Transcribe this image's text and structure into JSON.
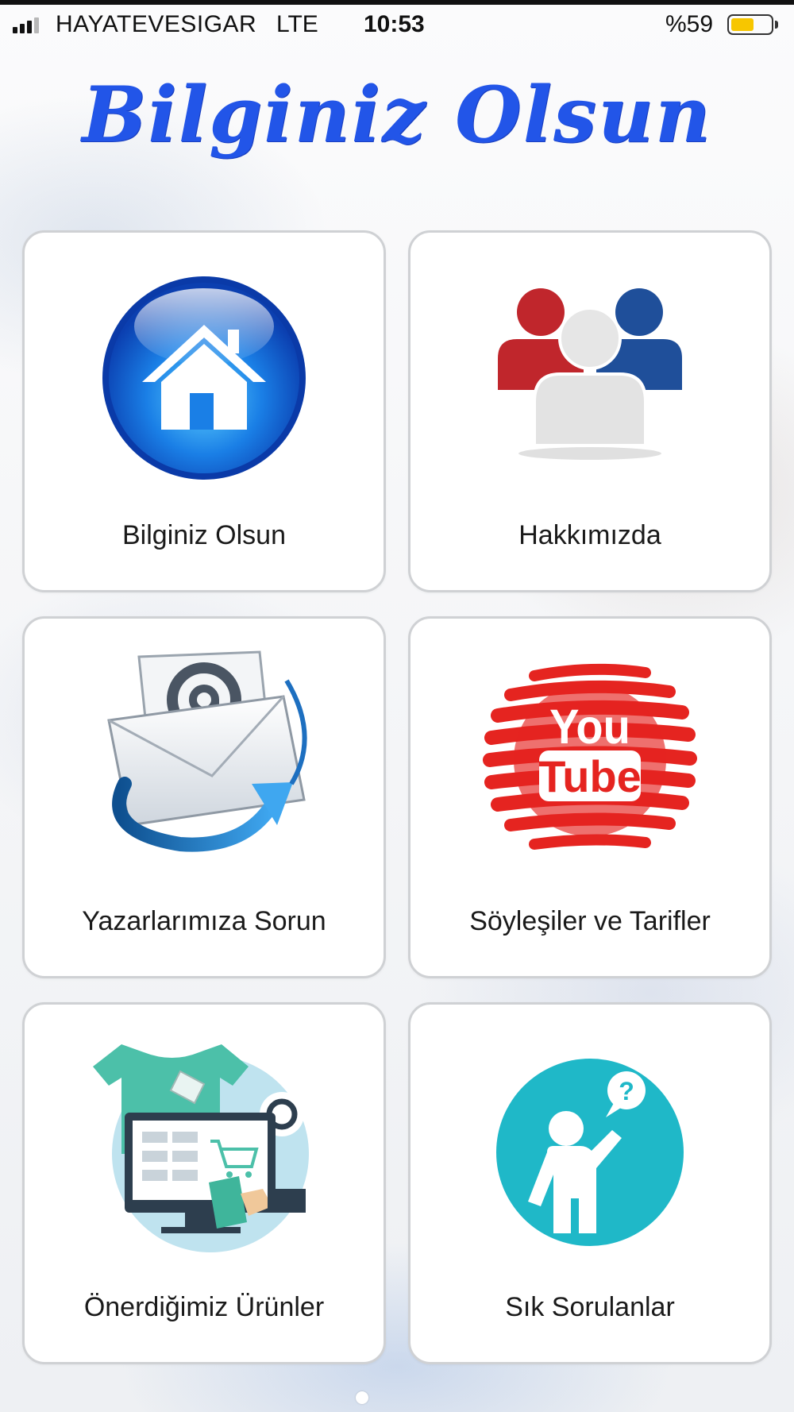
{
  "status_bar": {
    "carrier": "HAYATEVESIGAR",
    "network": "LTE",
    "time": "10:53",
    "battery_percent": "%59",
    "battery_level": 0.59,
    "battery_color": "#f7c600"
  },
  "header": {
    "title": "Bilginiz Olsun",
    "title_color": "#2255e8"
  },
  "menu": {
    "items": [
      {
        "label": "Bilginiz Olsun",
        "icon": "home-icon"
      },
      {
        "label": "Hakkımızda",
        "icon": "team-icon"
      },
      {
        "label": "Yazarlarımıza Sorun",
        "icon": "email-icon"
      },
      {
        "label": "Söyleşiler ve Tarifler",
        "icon": "youtube-icon"
      },
      {
        "label": "Önerdiğimiz Ürünler",
        "icon": "shopping-icon"
      },
      {
        "label": "Sık Sorulanlar",
        "icon": "faq-icon"
      }
    ]
  },
  "youtube_logo": {
    "line1": "You",
    "line2": "Tube"
  },
  "pagination": {
    "current_page": 1
  }
}
